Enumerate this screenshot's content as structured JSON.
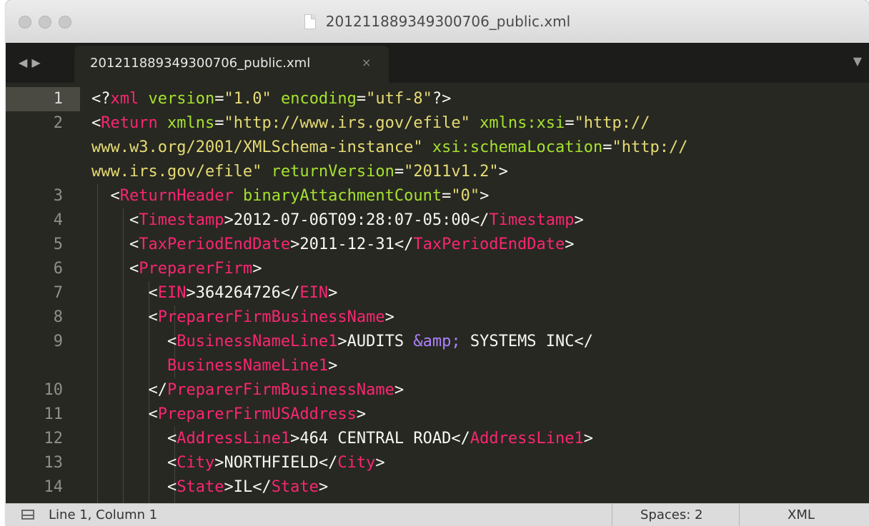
{
  "window": {
    "title": "201211889349300706_public.xml",
    "colors": {
      "background": "#272822",
      "tag": "#f92672",
      "attribute": "#a6e22e",
      "string": "#e6db74",
      "entity": "#ae81ff",
      "text": "#f8f8f2"
    }
  },
  "tabs": [
    {
      "label": "201211889349300706_public.xml",
      "close_glyph": "×",
      "active": true
    }
  ],
  "nav": {
    "back_glyph": "◀",
    "forward_glyph": "▶",
    "menu_glyph": "▼"
  },
  "editor": {
    "line_numbers": [
      "1",
      "2",
      "",
      "",
      "3",
      "4",
      "5",
      "6",
      "7",
      "8",
      "9",
      "",
      "10",
      "11",
      "12",
      "13",
      "14"
    ],
    "lines": [
      [
        [
          "pun",
          "<?"
        ],
        [
          "tag",
          "xml"
        ],
        [
          "pun",
          " "
        ],
        [
          "attr",
          "version"
        ],
        [
          "pun",
          "="
        ],
        [
          "str",
          "\"1.0\""
        ],
        [
          "pun",
          " "
        ],
        [
          "attr",
          "encoding"
        ],
        [
          "pun",
          "="
        ],
        [
          "str",
          "\"utf-8\""
        ],
        [
          "pun",
          "?>"
        ]
      ],
      [
        [
          "pun",
          "<"
        ],
        [
          "tag",
          "Return"
        ],
        [
          "pun",
          " "
        ],
        [
          "attr",
          "xmlns"
        ],
        [
          "pun",
          "="
        ],
        [
          "str",
          "\"http://www.irs.gov/efile\""
        ],
        [
          "pun",
          " "
        ],
        [
          "attr",
          "xmlns:xsi"
        ],
        [
          "pun",
          "="
        ],
        [
          "str",
          "\"http://"
        ]
      ],
      [
        [
          "str",
          "www.w3.org/2001/XMLSchema-instance\""
        ],
        [
          "pun",
          " "
        ],
        [
          "attr",
          "xsi:schemaLocation"
        ],
        [
          "pun",
          "="
        ],
        [
          "str",
          "\"http://"
        ]
      ],
      [
        [
          "str",
          "www.irs.gov/efile\""
        ],
        [
          "pun",
          " "
        ],
        [
          "attr",
          "returnVersion"
        ],
        [
          "pun",
          "="
        ],
        [
          "str",
          "\"2011v1.2\""
        ],
        [
          "pun",
          ">"
        ]
      ],
      [
        [
          "pun",
          "  <"
        ],
        [
          "tag",
          "ReturnHeader"
        ],
        [
          "pun",
          " "
        ],
        [
          "attr",
          "binaryAttachmentCount"
        ],
        [
          "pun",
          "="
        ],
        [
          "str",
          "\"0\""
        ],
        [
          "pun",
          ">"
        ]
      ],
      [
        [
          "pun",
          "    <"
        ],
        [
          "tag",
          "Timestamp"
        ],
        [
          "pun",
          ">2012-07-06T09:28:07-05:00</"
        ],
        [
          "tag",
          "Timestamp"
        ],
        [
          "pun",
          ">"
        ]
      ],
      [
        [
          "pun",
          "    <"
        ],
        [
          "tag",
          "TaxPeriodEndDate"
        ],
        [
          "pun",
          ">2011-12-31</"
        ],
        [
          "tag",
          "TaxPeriodEndDate"
        ],
        [
          "pun",
          ">"
        ]
      ],
      [
        [
          "pun",
          "    <"
        ],
        [
          "tag",
          "PreparerFirm"
        ],
        [
          "pun",
          ">"
        ]
      ],
      [
        [
          "pun",
          "      <"
        ],
        [
          "tag",
          "EIN"
        ],
        [
          "pun",
          ">364264726</"
        ],
        [
          "tag",
          "EIN"
        ],
        [
          "pun",
          ">"
        ]
      ],
      [
        [
          "pun",
          "      <"
        ],
        [
          "tag",
          "PreparerFirmBusinessName"
        ],
        [
          "pun",
          ">"
        ]
      ],
      [
        [
          "pun",
          "        <"
        ],
        [
          "tag",
          "BusinessNameLine1"
        ],
        [
          "pun",
          ">AUDITS "
        ],
        [
          "ent",
          "&amp;"
        ],
        [
          "pun",
          " SYSTEMS INC</"
        ]
      ],
      [
        [
          "pun",
          "        "
        ],
        [
          "tag",
          "BusinessNameLine1"
        ],
        [
          "pun",
          ">"
        ]
      ],
      [
        [
          "pun",
          "      </"
        ],
        [
          "tag",
          "PreparerFirmBusinessName"
        ],
        [
          "pun",
          ">"
        ]
      ],
      [
        [
          "pun",
          "      <"
        ],
        [
          "tag",
          "PreparerFirmUSAddress"
        ],
        [
          "pun",
          ">"
        ]
      ],
      [
        [
          "pun",
          "        <"
        ],
        [
          "tag",
          "AddressLine1"
        ],
        [
          "pun",
          ">464 CENTRAL ROAD</"
        ],
        [
          "tag",
          "AddressLine1"
        ],
        [
          "pun",
          ">"
        ]
      ],
      [
        [
          "pun",
          "        <"
        ],
        [
          "tag",
          "City"
        ],
        [
          "pun",
          ">NORTHFIELD</"
        ],
        [
          "tag",
          "City"
        ],
        [
          "pun",
          ">"
        ]
      ],
      [
        [
          "pun",
          "        <"
        ],
        [
          "tag",
          "State"
        ],
        [
          "pun",
          ">IL</"
        ],
        [
          "tag",
          "State"
        ],
        [
          "pun",
          ">"
        ]
      ]
    ]
  },
  "status": {
    "position": "Line 1, Column 1",
    "indentation": "Spaces: 2",
    "syntax": "XML"
  }
}
